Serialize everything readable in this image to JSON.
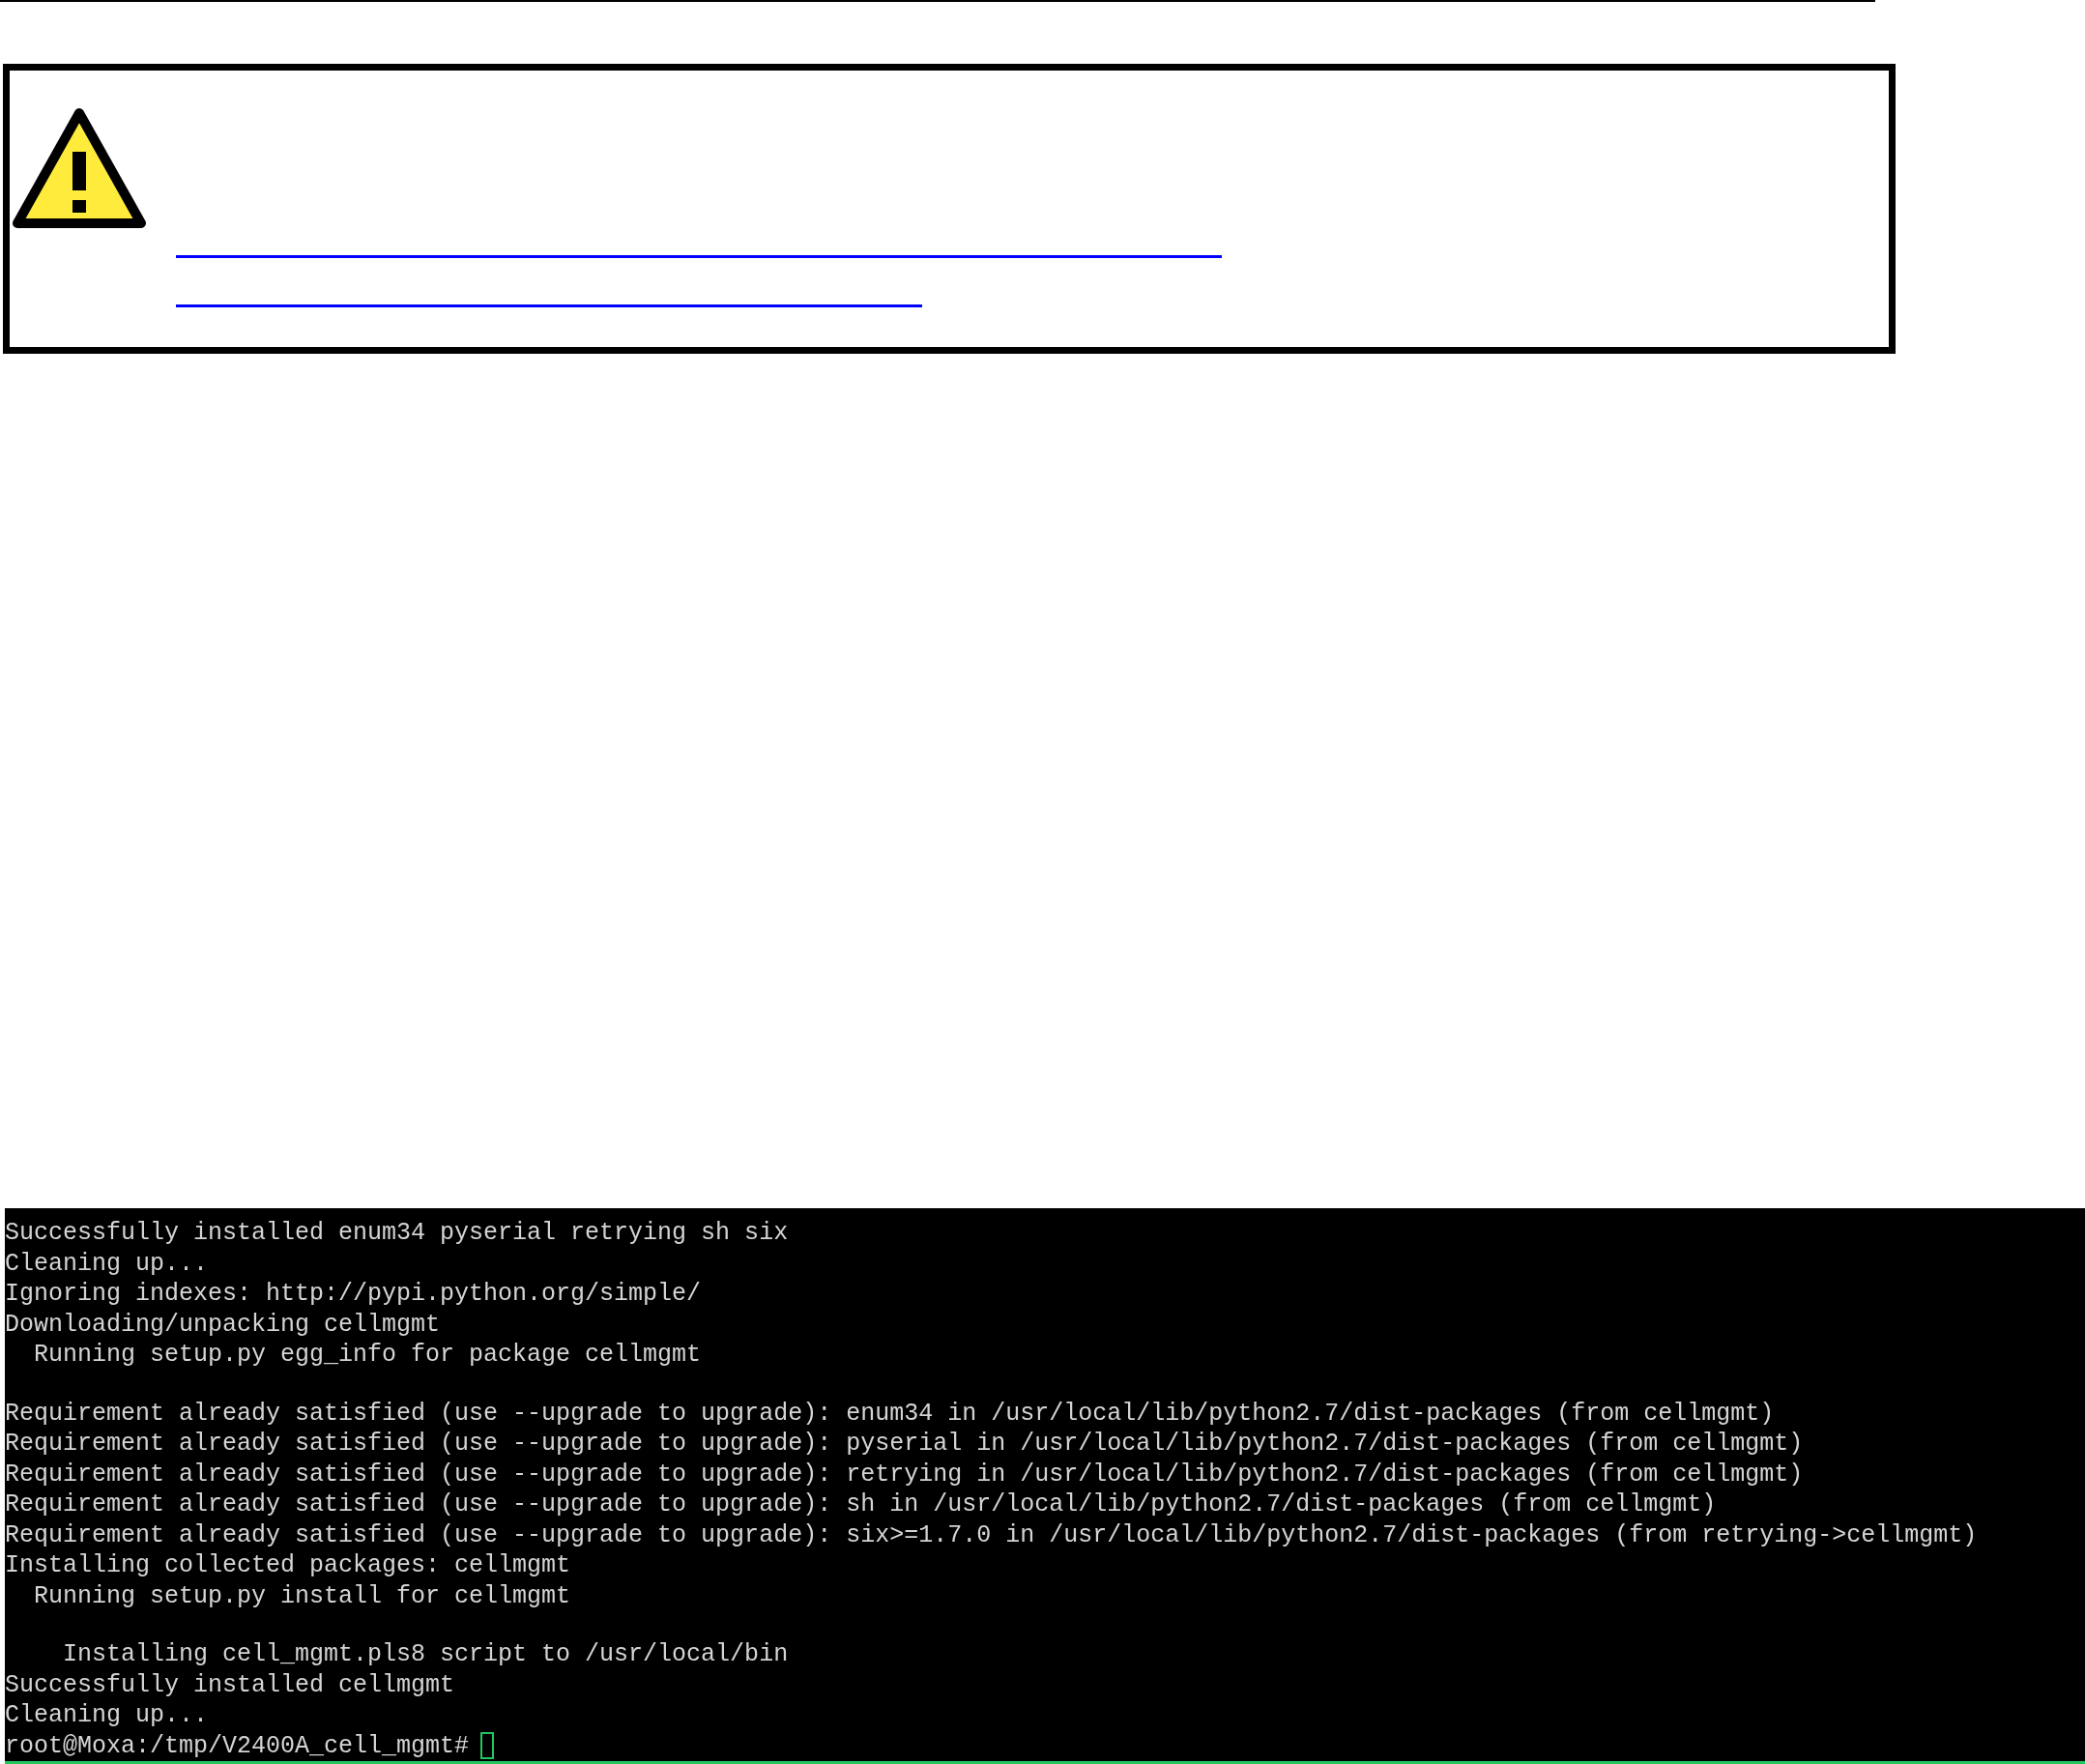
{
  "notice": {
    "links": [
      {
        "kind": "long"
      },
      {
        "kind": "short"
      }
    ]
  },
  "terminal": {
    "lines": [
      {
        "kind": "output",
        "text": "Successfully installed enum34 pyserial retrying sh six"
      },
      {
        "kind": "output",
        "text": "Cleaning up..."
      },
      {
        "kind": "output",
        "text": "Ignoring indexes: http://pypi.python.org/simple/"
      },
      {
        "kind": "output",
        "text": "Downloading/unpacking cellmgmt"
      },
      {
        "kind": "output",
        "text": "  Running setup.py egg_info for package cellmgmt"
      },
      {
        "kind": "blank"
      },
      {
        "kind": "output",
        "text": "Requirement already satisfied (use --upgrade to upgrade): enum34 in /usr/local/lib/python2.7/dist-packages (from cellmgmt)"
      },
      {
        "kind": "output",
        "text": "Requirement already satisfied (use --upgrade to upgrade): pyserial in /usr/local/lib/python2.7/dist-packages (from cellmgmt)"
      },
      {
        "kind": "output",
        "text": "Requirement already satisfied (use --upgrade to upgrade): retrying in /usr/local/lib/python2.7/dist-packages (from cellmgmt)"
      },
      {
        "kind": "output",
        "text": "Requirement already satisfied (use --upgrade to upgrade): sh in /usr/local/lib/python2.7/dist-packages (from cellmgmt)"
      },
      {
        "kind": "output",
        "text": "Requirement already satisfied (use --upgrade to upgrade): six>=1.7.0 in /usr/local/lib/python2.7/dist-packages (from retrying->cellmgmt)"
      },
      {
        "kind": "output",
        "text": "Installing collected packages: cellmgmt"
      },
      {
        "kind": "output",
        "text": "  Running setup.py install for cellmgmt"
      },
      {
        "kind": "blank"
      },
      {
        "kind": "output",
        "text": "    Installing cell_mgmt.pls8 script to /usr/local/bin"
      },
      {
        "kind": "output",
        "text": "Successfully installed cellmgmt"
      },
      {
        "kind": "output",
        "text": "Cleaning up..."
      }
    ],
    "prompt": "root@Moxa:/tmp/V2400A_cell_mgmt#"
  }
}
